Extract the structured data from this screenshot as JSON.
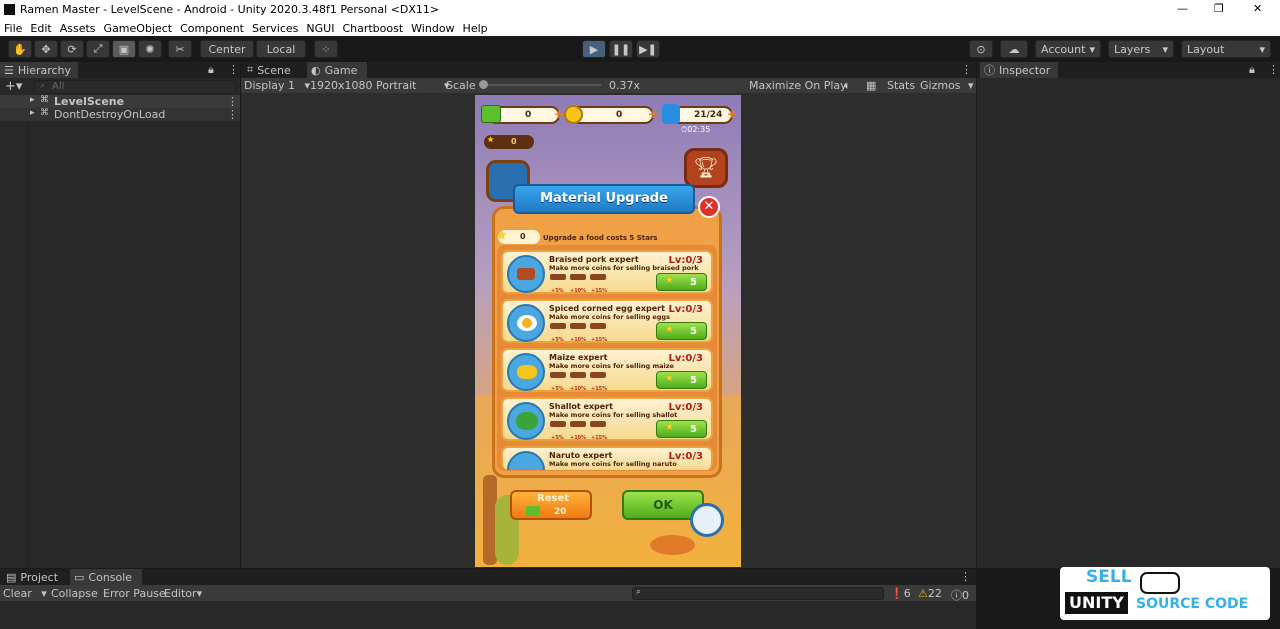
{
  "window": {
    "title": "Ramen Master - LevelScene - Android - Unity 2020.3.48f1 Personal <DX11>",
    "min": "—",
    "max": "❐",
    "close": "✕"
  },
  "menu": [
    "File",
    "Edit",
    "Assets",
    "GameObject",
    "Component",
    "Services",
    "NGUI",
    "Chartboost",
    "Window",
    "Help"
  ],
  "toolbar": {
    "center": "Center",
    "local": "Local",
    "account": "Account",
    "layers": "Layers",
    "layout": "Layout"
  },
  "hierarchy": {
    "tab": "Hierarchy",
    "search_placeholder": "All",
    "items": [
      "LevelScene",
      "DontDestroyOnLoad"
    ]
  },
  "gameview": {
    "scene_tab": "Scene",
    "game_tab": "Game",
    "display": "Display 1",
    "resolution": "1920x1080 Portrait",
    "scale_label": "Scale",
    "scale_value": "0.37x",
    "maximize": "Maximize On Play",
    "stats": "Stats",
    "gizmos": "Gizmos"
  },
  "inspector": {
    "tab": "Inspector"
  },
  "bottom": {
    "project_tab": "Project",
    "console_tab": "Console",
    "clear": "Clear",
    "collapse": "Collapse",
    "error_pause": "Error Pause",
    "editor": "Editor",
    "count_info": "6",
    "count_warn": "22",
    "count_err": "0"
  },
  "game": {
    "cash": "0",
    "coins": "0",
    "energy": "21/24",
    "timer": "02:35",
    "stars": "0",
    "dialog_title": "Material Upgrade",
    "upgrade_stars": "0",
    "upgrade_info": "Upgrade a food costs 5 Stars",
    "pct": [
      "+5%",
      "+10%",
      "+15%"
    ],
    "items": [
      {
        "title": "Braised pork expert",
        "desc": "Make more coins for selling braised pork",
        "level": "Lv:0/3",
        "cost": "5"
      },
      {
        "title": "Spiced corned egg expert",
        "desc": "Make more coins for selling eggs",
        "level": "Lv:0/3",
        "cost": "5"
      },
      {
        "title": "Maize expert",
        "desc": "Make more coins for selling maize",
        "level": "Lv:0/3",
        "cost": "5"
      },
      {
        "title": "Shallot expert",
        "desc": "Make more coins for selling shallot",
        "level": "Lv:0/3",
        "cost": "5"
      },
      {
        "title": "Naruto expert",
        "desc": "Make more coins for selling naruto",
        "level": "Lv:0/3"
      }
    ],
    "reset_label": "Reset",
    "reset_cost": "20",
    "ok_label": "OK"
  },
  "watermark": {
    "line1": "SELL",
    "line2": "UNITY",
    "line3": "SOURCE CODE"
  }
}
